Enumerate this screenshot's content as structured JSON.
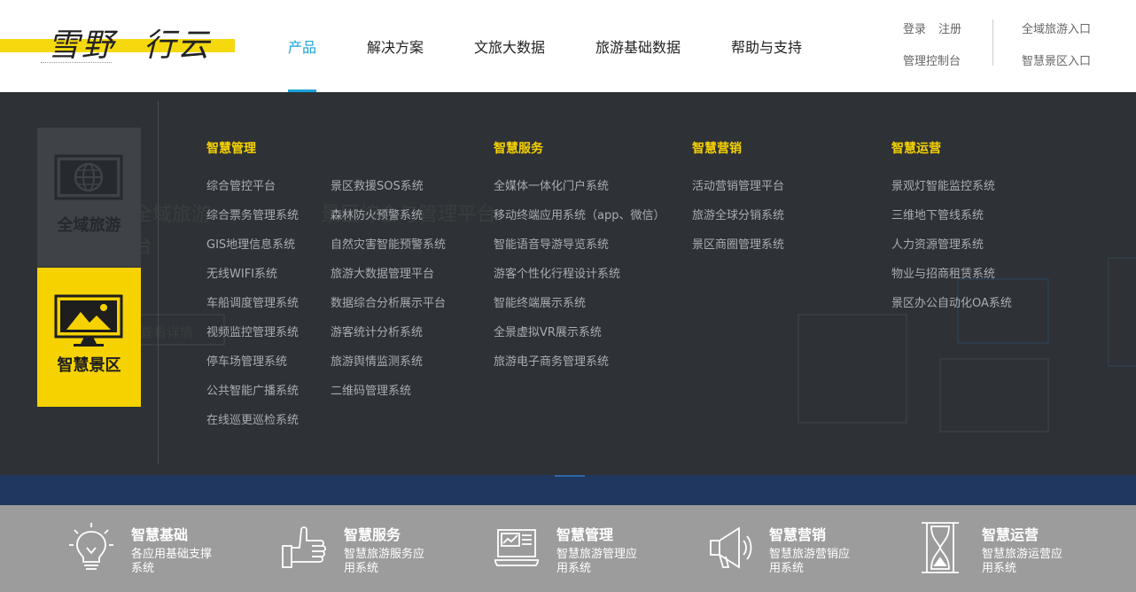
{
  "logo": {
    "part1": "雪野",
    "part2": "行云"
  },
  "nav": {
    "items": [
      "产品",
      "解决方案",
      "文旅大数据",
      "旅游基础数据",
      "帮助与支持"
    ],
    "active_index": 0
  },
  "top_links": {
    "login": "登录",
    "register": "注册",
    "console": "管理控制台",
    "global_tourism_entry": "全域旅游入口",
    "smart_scenic_entry": "智慧景区入口"
  },
  "background_ghost": {
    "title_a": "全域旅游",
    "title_b": "景区综合与管理平台",
    "line2": "台",
    "button": "查看详情"
  },
  "side_cards": [
    {
      "label": "全域旅游",
      "icon": "globe-monitor-icon",
      "selected": false
    },
    {
      "label": "智慧景区",
      "icon": "landscape-monitor-icon",
      "selected": true
    }
  ],
  "menu": {
    "management": {
      "title": "智慧管理",
      "col1": [
        "综合管控平台",
        "综合票务管理系统",
        "GIS地理信息系统",
        "无线WIFI系统",
        "车船调度管理系统",
        "视频监控管理系统",
        "停车场管理系统",
        "公共智能广播系统",
        "在线巡更巡检系统"
      ],
      "col2": [
        "景区救援SOS系统",
        "森林防火预警系统",
        "自然灾害智能预警系统",
        "旅游大数据管理平台",
        "数据综合分析展示平台",
        "游客统计分析系统",
        "旅游舆情监测系统",
        "二维码管理系统"
      ]
    },
    "service": {
      "title": "智慧服务",
      "items": [
        "全媒体一体化门户系统",
        "移动终端应用系统（app、微信）",
        "智能语音导游导览系统",
        "游客个性化行程设计系统",
        "智能终端展示系统",
        "全景虚拟VR展示系统",
        "旅游电子商务管理系统"
      ]
    },
    "marketing": {
      "title": "智慧营销",
      "items": [
        "活动营销管理平台",
        "旅游全球分销系统",
        "景区商圈管理系统"
      ]
    },
    "operation": {
      "title": "智慧运营",
      "items": [
        "景观灯智能监控系统",
        "三维地下管线系统",
        "人力资源管理系统",
        "物业与招商租赁系统",
        "景区办公自动化OA系统"
      ]
    }
  },
  "features": [
    {
      "title": "智慧基础",
      "desc": "各应用基础支撑系统",
      "icon": "lightbulb-icon"
    },
    {
      "title": "智慧服务",
      "desc": "智慧旅游服务应用系统",
      "icon": "thumbs-up-icon"
    },
    {
      "title": "智慧管理",
      "desc": "智慧旅游管理应用系统",
      "icon": "laptop-chart-icon"
    },
    {
      "title": "智慧营销",
      "desc": "智慧旅游营销应用系统",
      "icon": "megaphone-icon"
    },
    {
      "title": "智慧运营",
      "desc": "智慧旅游运营应用系统",
      "icon": "hourglass-icon"
    }
  ],
  "colors": {
    "accent_yellow": "#f6d200",
    "nav_active": "#1aa2d8",
    "panel_bg": "#2e3135",
    "bottom_bar": "#9c9c9c"
  }
}
